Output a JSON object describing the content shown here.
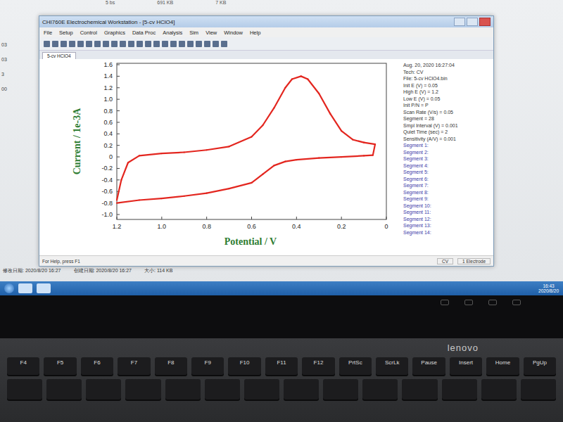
{
  "desktop": {
    "top_files": [
      "5 bs",
      "691 KB",
      "7 KB"
    ],
    "left_items": [
      "03",
      "03",
      "3",
      "00"
    ]
  },
  "window": {
    "title": "CHI760E Electrochemical Workstation - [5-cv HClO4]",
    "menu": [
      "File",
      "Setup",
      "Control",
      "Graphics",
      "Data Proc",
      "Analysis",
      "Sim",
      "View",
      "Window",
      "Help"
    ],
    "tab": "5-cv HClO4"
  },
  "chart": {
    "y_label": "Current / 1e-3A",
    "x_label": "Potential / V",
    "y_ticks": [
      "1.6",
      "1.4",
      "1.2",
      "1.0",
      "0.8",
      "0.6",
      "0.4",
      "0.2",
      "0",
      "-0.2",
      "-0.4",
      "-0.6",
      "-0.8",
      "-1.0"
    ],
    "x_ticks": [
      "1.2",
      "1.0",
      "0.8",
      "0.6",
      "0.4",
      "0.2",
      "0"
    ],
    "series": [
      {
        "potentials": [
          0.05,
          0.1,
          0.15,
          0.2,
          0.25,
          0.3,
          0.35,
          0.38,
          0.42,
          0.45,
          0.5,
          0.55,
          0.6,
          0.7,
          0.8,
          0.9,
          1.0,
          1.1,
          1.15,
          1.18,
          1.2
        ],
        "values": [
          0.22,
          0.25,
          0.3,
          0.45,
          0.75,
          1.1,
          1.35,
          1.4,
          1.35,
          1.2,
          0.85,
          0.55,
          0.35,
          0.18,
          0.12,
          0.08,
          0.06,
          0.02,
          -0.1,
          -0.4,
          -0.75
        ]
      },
      {
        "potentials": [
          1.2,
          1.1,
          1.0,
          0.9,
          0.8,
          0.7,
          0.6,
          0.55,
          0.5,
          0.45,
          0.4,
          0.3,
          0.2,
          0.1,
          0.06,
          0.05
        ],
        "values": [
          -0.8,
          -0.75,
          -0.72,
          -0.68,
          -0.63,
          -0.55,
          -0.45,
          -0.3,
          -0.15,
          -0.08,
          -0.05,
          -0.02,
          0.0,
          0.02,
          0.03,
          0.22
        ]
      }
    ]
  },
  "info": {
    "header": "Aug. 20, 2020   16:27:04",
    "params": [
      "Tech: CV",
      "File: 5-cv HClO4.bin",
      "Init E (V) = 0.05",
      "High E (V) = 1.2",
      "Low E (V) = 0.05",
      "Init P/N = P",
      "Scan Rate (V/s) = 0.05",
      "Segment = 28",
      "Smpl Interval (V) = 0.001",
      "Quiet Time (sec) = 2",
      "Sensitivity (A/V) = 0.001"
    ],
    "segments": [
      "Segment 1:",
      "Segment 2:",
      "Segment 3:",
      "Segment 4:",
      "Segment 5:",
      "Segment 6:",
      "Segment 7:",
      "Segment 8:",
      "Segment 9:",
      "Segment 10:",
      "Segment 11:",
      "Segment 12:",
      "Segment 13:",
      "Segment 14:"
    ]
  },
  "status_bar": {
    "help": "For Help, press F1",
    "mode": "CV",
    "electrode": "1 Electrode"
  },
  "file_info": [
    "修改日期: 2020/8/20 16:27",
    "创建日期: 2020/8/20 16:27",
    "大小: 114 KB"
  ],
  "taskbar": {
    "time": "16:43",
    "date": "2020/8/20"
  },
  "keyboard": {
    "brand": "lenovo",
    "keys": [
      "F4",
      "F5",
      "F6",
      "F7",
      "F8",
      "F9",
      "F10",
      "F11",
      "F12",
      "PrtSc",
      "ScrLk",
      "Pause",
      "Insert",
      "Home",
      "PgUp"
    ]
  }
}
